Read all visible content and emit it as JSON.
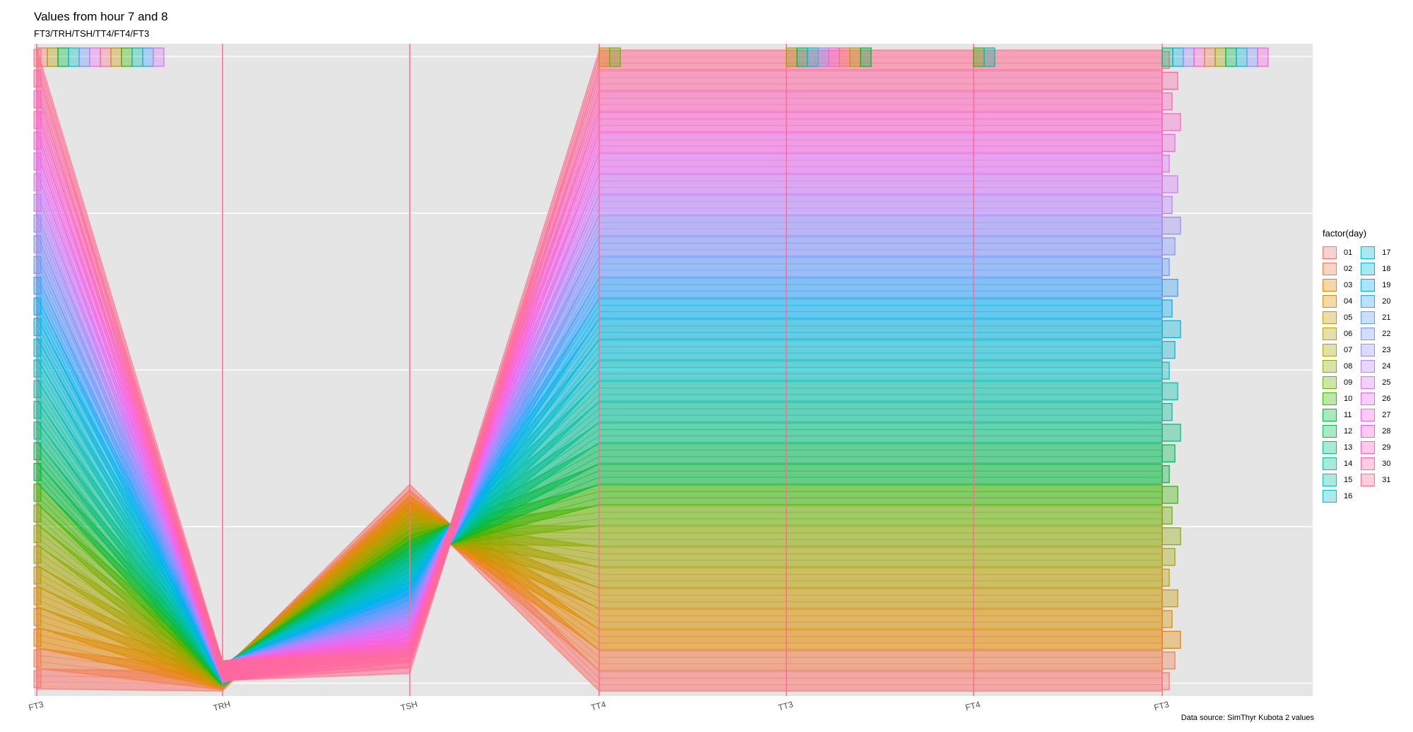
{
  "title": "Values from hour 7 and 8",
  "subtitle": "FT3/TRH/TSH/TT4/FT4/FT3",
  "caption": "Data source: SimThyr Kubota 2 values",
  "legend": {
    "title": "factor(day)",
    "entries": [
      "01",
      "02",
      "03",
      "04",
      "05",
      "06",
      "07",
      "08",
      "09",
      "10",
      "11",
      "12",
      "13",
      "14",
      "15",
      "16",
      "17",
      "18",
      "19",
      "20",
      "21",
      "22",
      "23",
      "24",
      "25",
      "26",
      "27",
      "28",
      "29",
      "30",
      "31"
    ],
    "colors": [
      "#F8766D",
      "#F07E4A",
      "#E58700",
      "#D89000",
      "#C99800",
      "#B79F00",
      "#A3A500",
      "#8BAB00",
      "#6BB100",
      "#39B600",
      "#00BA38",
      "#00BC56",
      "#00BF7D",
      "#00C097",
      "#00C1AA",
      "#00BFC4",
      "#00BBD4",
      "#00B6E2",
      "#00B0F6",
      "#35A2FF",
      "#619CFF",
      "#7F96FF",
      "#9590FF",
      "#B983FF",
      "#D478F9",
      "#E76BF3",
      "#F564E3",
      "#FD61D1",
      "#FF62BC",
      "#FF67A4",
      "#FF6C91"
    ]
  },
  "chart_data": {
    "type": "line",
    "style": "parallel-coordinates with per-axis histograms",
    "axes": [
      "FT3",
      "TRH",
      "TSH",
      "TT4",
      "TT3",
      "FT4",
      "FT3"
    ],
    "grid": true,
    "legend_position": "right",
    "series_by": "factor(day)",
    "days": [
      "01",
      "02",
      "03",
      "04",
      "05",
      "06",
      "07",
      "08",
      "09",
      "10",
      "11",
      "12",
      "13",
      "14",
      "15",
      "16",
      "17",
      "18",
      "19",
      "20",
      "21",
      "22",
      "23",
      "24",
      "25",
      "26",
      "27",
      "28",
      "29",
      "30",
      "31"
    ]
  }
}
